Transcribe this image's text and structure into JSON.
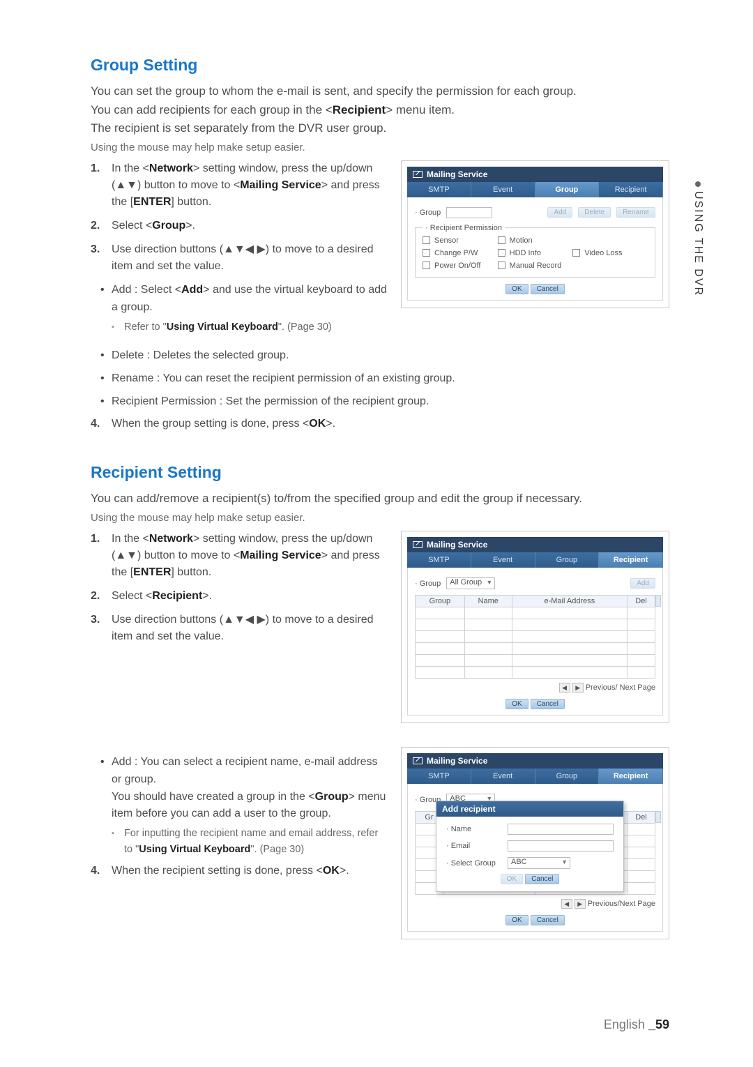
{
  "sideTab": "USING THE DVR",
  "sec1": {
    "heading": "Group Setting",
    "p1": "You can set the group to whom the e-mail is sent, and specify the permission for each group.",
    "p2": "You can add recipients for each group in the <",
    "p2b": "Recipient",
    "p2c": "> menu item.",
    "p3": "The recipient is set separately from the DVR user group.",
    "note": "Using the mouse may help make setup easier.",
    "li1a": "In the <",
    "li1b": "Network",
    "li1c": "> setting window, press the up/down (▲▼) button to move to <",
    "li1d": "Mailing Service",
    "li1e": "> and press the [",
    "li1f": "ENTER",
    "li1g": "] button.",
    "li2a": "Select <",
    "li2b": "Group",
    "li2c": ">.",
    "li3": "Use direction buttons (▲▼◀ ▶) to move to a desired item and set the value.",
    "b1a": "Add : Select <",
    "b1b": "Add",
    "b1c": "> and use the virtual keyboard to add a group.",
    "sub1a": "Refer to \"",
    "sub1b": "Using Virtual Keyboard",
    "sub1c": "\". (Page 30)",
    "b2": "Delete : Deletes the selected group.",
    "b3": "Rename : You can reset the recipient permission of an existing group.",
    "b4": "Recipient Permission : Set the permission of the recipient group.",
    "li4a": "When the group setting is done, press <",
    "li4b": "OK",
    "li4c": ">."
  },
  "shot1": {
    "title": "Mailing Service",
    "tabs": [
      "SMTP",
      "Event",
      "Group",
      "Recipient"
    ],
    "groupLabel": "· Group",
    "btnAdd": "Add",
    "btnDelete": "Delete",
    "btnRename": "Rename",
    "legend": "· Recipient Permission",
    "perm": [
      "Sensor",
      "Motion",
      "",
      "Change P/W",
      "HDD Info",
      "Video Loss",
      "Power On/Off",
      "Manual Record",
      ""
    ],
    "ok": "OK",
    "cancel": "Cancel"
  },
  "sec2": {
    "heading": "Recipient Setting",
    "p1": "You can add/remove a recipient(s) to/from the specified group and edit the group if necessary.",
    "note": "Using the mouse may help make setup easier.",
    "li1a": "In the <",
    "li1b": "Network",
    "li1c": "> setting window, press the up/down (▲▼) button to move to <",
    "li1d": "Mailing Service",
    "li1e": "> and press the [",
    "li1f": "ENTER",
    "li1g": "] button.",
    "li2a": "Select <",
    "li2b": "Recipient",
    "li2c": ">.",
    "li3": "Use direction buttons (▲▼◀ ▶) to move to a desired item and set the value.",
    "b1a": "Add : You can select a recipient name, e-mail address or group.",
    "b1b": "You should have created a group in the <",
    "b1c": "Group",
    "b1d": "> menu item before you can add a user to the group.",
    "sub1a": "For inputting the recipient name and email address, refer to \"",
    "sub1b": "Using Virtual Keyboard",
    "sub1c": "\". (Page 30)",
    "li4a": "When the recipient setting is done, press <",
    "li4b": "OK",
    "li4c": ">."
  },
  "shot2": {
    "title": "Mailing Service",
    "tabs": [
      "SMTP",
      "Event",
      "Group",
      "Recipient"
    ],
    "groupLabel": "· Group",
    "groupSel": "All Group",
    "addBtn": "Add",
    "cols": [
      "Group",
      "Name",
      "e-Mail Address",
      "Del"
    ],
    "pager": "Previous/ Next Page",
    "ok": "OK",
    "cancel": "Cancel"
  },
  "shot3": {
    "title": "Mailing Service",
    "tabs": [
      "SMTP",
      "Event",
      "Group",
      "Recipient"
    ],
    "groupLabel": "· Group",
    "groupSel": "ABC",
    "cols": [
      "Gr",
      "",
      "",
      "Del"
    ],
    "modal": {
      "title": "Add recipient",
      "name": "· Name",
      "email": "· Email",
      "selGroup": "· Select Group",
      "selVal": "ABC",
      "ok": "OK",
      "cancel": "Cancel"
    },
    "pager": "Previous/Next Page",
    "ok": "OK",
    "cancel": "Cancel"
  },
  "footer": {
    "lang": "English ",
    "page": "_59"
  }
}
